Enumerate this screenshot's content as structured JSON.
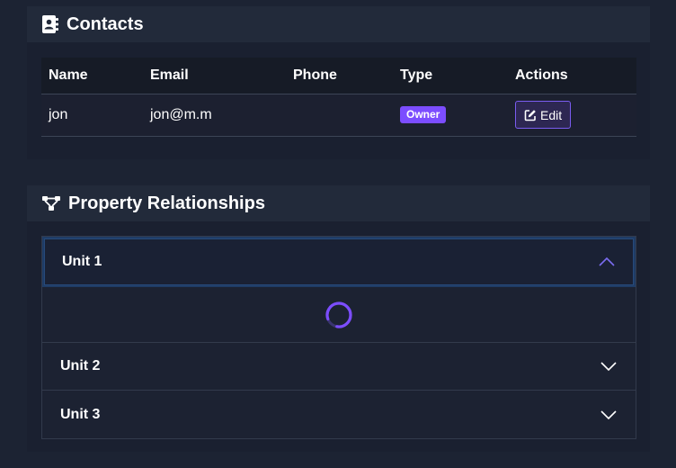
{
  "contacts": {
    "title": "Contacts",
    "icon": "address-book-icon",
    "columns": [
      "Name",
      "Email",
      "Phone",
      "Type",
      "Actions"
    ],
    "rows": [
      {
        "name": "jon",
        "email": "jon@m.m",
        "phone": "",
        "type": "Owner",
        "action": "Edit"
      }
    ]
  },
  "relationships": {
    "title": "Property Relationships",
    "icon": "sitemap-icon",
    "units": [
      {
        "label": "Unit 1",
        "expanded": true,
        "loading": true
      },
      {
        "label": "Unit 2",
        "expanded": false
      },
      {
        "label": "Unit 3",
        "expanded": false
      }
    ]
  },
  "colors": {
    "accent": "#7c4dff",
    "background": "#1c2333"
  }
}
